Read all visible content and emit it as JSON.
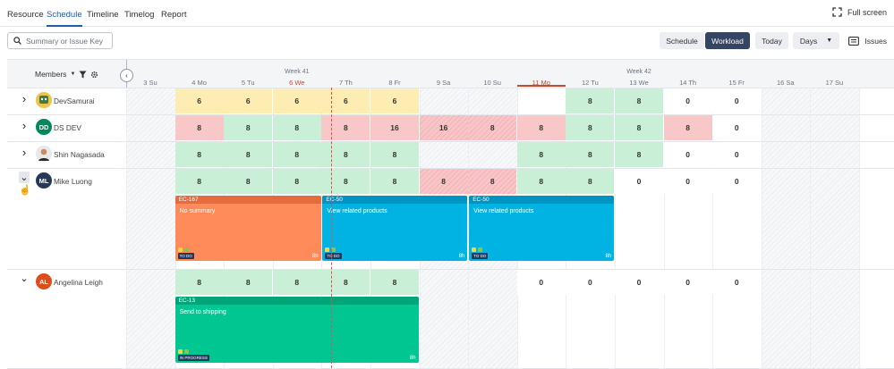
{
  "tabs": [
    "Resource",
    "Schedule",
    "Timeline",
    "Timelog",
    "Report"
  ],
  "fullscreen": "Full screen",
  "search": {
    "placeholder": "Summary or Issue Key"
  },
  "views": {
    "schedule": "Schedule",
    "workload": "Workload",
    "today": "Today",
    "days": "Days",
    "issues": "Issues"
  },
  "members_label": "Members",
  "weeks": [
    "Week 41",
    "Week 42"
  ],
  "days": [
    "3 Su",
    "4 Mo",
    "5 Tu",
    "6 We",
    "7 Th",
    "8 Fr",
    "9 Sa",
    "10 Su",
    "11 Mo",
    "12 Tu",
    "13 We",
    "14 Th",
    "15 Fr",
    "16 Sa",
    "17 Su"
  ],
  "members": [
    {
      "name": "DevSamurai",
      "initials": "",
      "values": [
        "",
        "6",
        "6",
        "6",
        "6",
        "6",
        "",
        "",
        "",
        "8",
        "8",
        "0",
        "0",
        "",
        ""
      ]
    },
    {
      "name": "DS DEV",
      "initials": "DD",
      "values": [
        "",
        "8",
        "8",
        "8",
        "8",
        "16",
        "16",
        "8",
        "8",
        "8",
        "8",
        "8",
        "0",
        "",
        ""
      ]
    },
    {
      "name": "Shin Nagasada",
      "initials": "",
      "values": [
        "",
        "8",
        "8",
        "8",
        "8",
        "8",
        "",
        "",
        "8",
        "8",
        "8",
        "0",
        "0",
        "",
        ""
      ]
    },
    {
      "name": "Mike Luong",
      "initials": "ML",
      "values": [
        "",
        "8",
        "8",
        "8",
        "8",
        "8",
        "8",
        "8",
        "8",
        "8",
        "0",
        "0",
        "0",
        "",
        ""
      ]
    },
    {
      "name": "Angelina Leigh",
      "initials": "AL",
      "values": [
        "",
        "8",
        "8",
        "8",
        "8",
        "8",
        "",
        "",
        "0",
        "0",
        "0",
        "0",
        "0",
        "",
        ""
      ]
    }
  ],
  "cards": [
    {
      "key": "EC-167",
      "title": "No summary",
      "status": "TO DO",
      "hours": "8h"
    },
    {
      "key": "EC-50",
      "title": "View related products",
      "status": "TO DO",
      "hours": "8h"
    },
    {
      "key": "EC-50",
      "title": "View related products",
      "status": "TO DO",
      "hours": "8h"
    },
    {
      "key": "EC-13",
      "title": "Send to shipping",
      "status": "IN PROGRESS",
      "hours": "8h"
    }
  ],
  "colors": {
    "accent": "#1f5fa8",
    "dark": "#344563",
    "orange": "#ff8b5b",
    "blue": "#00b3e3",
    "green": "#00c791",
    "today": "#c24b30"
  }
}
